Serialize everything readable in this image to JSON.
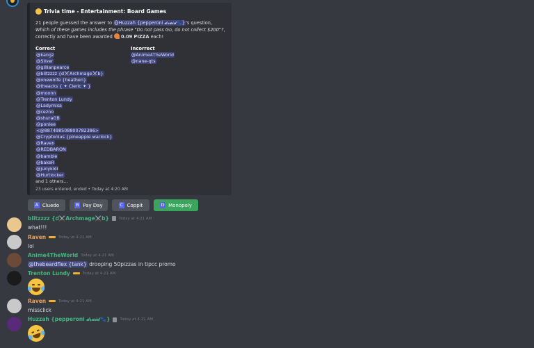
{
  "embed": {
    "title": "Trivia time - Entertainment: Board Games",
    "desc_prefix": "21 people guessed the answer to ",
    "asker_mention": "@Huzzah {pepperoni 𝓭𝓻𝓾𝓲𝓭🐾}",
    "desc_mid1": "'s question, ",
    "question": "Which of these games includes the phrase \"Do not pass Go, do not collect $200\"?",
    "desc_mid2": ", correctly and have been awarded ",
    "award": "0.09 PIZZA",
    "desc_suffix": " each!",
    "correct_label": "Correct",
    "correct": [
      "@kangz",
      "@Silver",
      "@gillianpearce",
      "@blitzzzz {d⚔️Archmage⚔️b}",
      "@onewolfe {heathen}",
      "@theacks { ✦ Cleric ✦ }",
      "@moonn",
      "@Trenton Lundy",
      "@Ladymisa",
      "@cezno",
      "@shuraGB",
      "@poniee",
      "<@887498508800782386>",
      "@Cryptonius {pineapple warlock}",
      "@Raven",
      "@REDBARON",
      "@bambie",
      "@bakeR",
      "@junykidi",
      "@Hurtlocker"
    ],
    "correct_more": "and 1 others...",
    "incorrect_label": "Incorrect",
    "incorrect": [
      "@Anime4TheWorld",
      "@nane-qts"
    ],
    "footer": "23 users entered, ended • Today at 4:20 AM"
  },
  "buttons": [
    {
      "letter": "A",
      "label": "Cluedo"
    },
    {
      "letter": "B",
      "label": "Pay Day"
    },
    {
      "letter": "C",
      "label": "Coppit"
    },
    {
      "letter": "D",
      "label": "Monopoly"
    }
  ],
  "messages": [
    {
      "user": "blitzzzz {d⚔️Archmage⚔️b}",
      "color": "#43b581",
      "time": "Today at 4:21 AM",
      "text": "what!!!"
    },
    {
      "user": "Raven",
      "color": "#e8a25b",
      "time": "Today at 4:21 AM",
      "text": "lol"
    },
    {
      "user": "Anime4TheWorld",
      "color": "#43b581",
      "time": "Today at 4:21 AM",
      "mention": "@thebeardflex {tank}",
      "text": " drooping 50pizzas in tipcc promo"
    },
    {
      "user": "Trenton Lundy",
      "color": "#43b581",
      "time": "Today at 4:21 AM",
      "emoji": "joy"
    },
    {
      "user": "Raven",
      "color": "#e8a25b",
      "time": "Today at 4:21 AM",
      "text": "missclick"
    },
    {
      "user": "Huzzah {pepperoni 𝓭𝓻𝓾𝓲𝓭🐾}",
      "color": "#43b581",
      "time": "Today at 4:21 AM",
      "emoji": "rofl"
    }
  ],
  "colors": {
    "background": "#36393f",
    "embed_bg": "#2f3136",
    "mention_bg": "#414675",
    "button_green": "#3ba55d",
    "button_grey": "#4f545c"
  }
}
